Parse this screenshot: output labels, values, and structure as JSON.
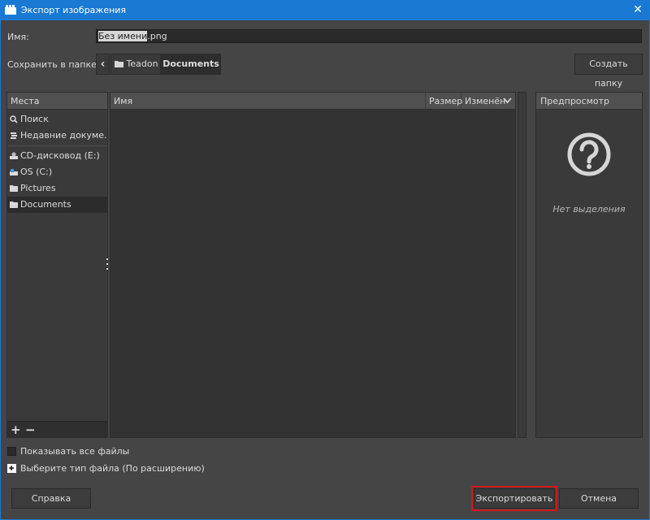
{
  "window": {
    "title": "Экспорт изображения",
    "close_glyph": "✕"
  },
  "name_row": {
    "label": "Имя:",
    "value_selected": "Без имени",
    "value_rest": ".png"
  },
  "folder_row": {
    "label": "Сохранить в папке",
    "back_glyph": "‹",
    "crumbs": [
      "Teadon",
      "Documents"
    ],
    "create_button": "Создать папку"
  },
  "places": {
    "header": "Места",
    "items": [
      {
        "label": "Поиск",
        "icon": "search-icon"
      },
      {
        "label": "Недавние докуме...",
        "icon": "recent-icon"
      },
      {
        "label": "CD-дисковод (E:)",
        "icon": "cd-drive-icon"
      },
      {
        "label": "OS (C:)",
        "icon": "hard-drive-icon"
      },
      {
        "label": "Pictures",
        "icon": "folder-icon"
      },
      {
        "label": "Documents",
        "icon": "folder-icon",
        "selected": true
      }
    ],
    "add_glyph": "+",
    "remove_glyph": "−"
  },
  "files": {
    "col_name": "Имя",
    "col_size": "Размер",
    "col_modified": "Изменён"
  },
  "preview": {
    "header": "Предпросмотр",
    "no_selection": "Нет выделения"
  },
  "options": {
    "show_all": "Показывать все файлы",
    "file_type": "Выберите тип файла (По расширению)"
  },
  "buttons": {
    "help": "Справка",
    "export": "Экспортировать",
    "cancel": "Отмена"
  },
  "colors": {
    "titlebar": "#1979d3",
    "highlight": "#d0161d"
  }
}
